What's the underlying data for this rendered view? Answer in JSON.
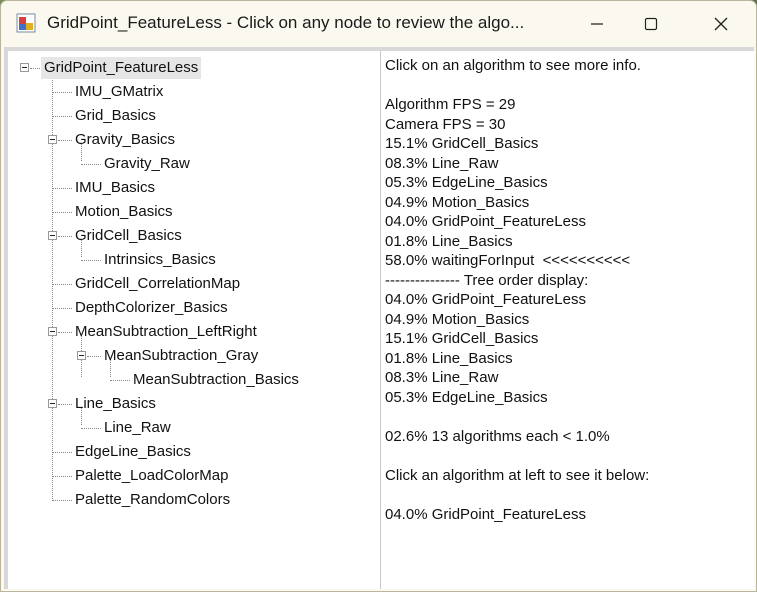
{
  "window": {
    "title": "GridPoint_FeatureLess - Click on any node to review the algo..."
  },
  "tree": {
    "root": "GridPoint_FeatureLess",
    "nodes": [
      {
        "label": "IMU_GMatrix",
        "level": 1
      },
      {
        "label": "Grid_Basics",
        "level": 1
      },
      {
        "label": "Gravity_Basics",
        "level": 1,
        "expanded": true
      },
      {
        "label": "Gravity_Raw",
        "level": 2
      },
      {
        "label": "IMU_Basics",
        "level": 1
      },
      {
        "label": "Motion_Basics",
        "level": 1
      },
      {
        "label": "GridCell_Basics",
        "level": 1,
        "expanded": true
      },
      {
        "label": "Intrinsics_Basics",
        "level": 2
      },
      {
        "label": "GridCell_CorrelationMap",
        "level": 1
      },
      {
        "label": "DepthColorizer_Basics",
        "level": 1
      },
      {
        "label": "MeanSubtraction_LeftRight",
        "level": 1,
        "expanded": true
      },
      {
        "label": "MeanSubtraction_Gray",
        "level": 2,
        "expanded": true
      },
      {
        "label": "MeanSubtraction_Basics",
        "level": 3
      },
      {
        "label": "Line_Basics",
        "level": 1,
        "expanded": true
      },
      {
        "label": "Line_Raw",
        "level": 2
      },
      {
        "label": "EdgeLine_Basics",
        "level": 1
      },
      {
        "label": "Palette_LoadColorMap",
        "level": 1
      },
      {
        "label": "Palette_RandomColors",
        "level": 1
      }
    ]
  },
  "info": {
    "lines": [
      "Click on an algorithm to see more info.",
      "",
      "Algorithm FPS = 29",
      "Camera FPS = 30",
      "15.1% GridCell_Basics",
      "08.3% Line_Raw",
      "05.3% EdgeLine_Basics",
      "04.9% Motion_Basics",
      "04.0% GridPoint_FeatureLess",
      "01.8% Line_Basics",
      "58.0% waitingForInput  <<<<<<<<<<",
      "--------------- Tree order display:",
      "04.0% GridPoint_FeatureLess",
      "04.9% Motion_Basics",
      "15.1% GridCell_Basics",
      "01.8% Line_Basics",
      "08.3% Line_Raw",
      "05.3% EdgeLine_Basics",
      "",
      "02.6% 13 algorithms each < 1.0%",
      "",
      "Click an algorithm at left to see it below:",
      "",
      "04.0% GridPoint_FeatureLess"
    ]
  }
}
